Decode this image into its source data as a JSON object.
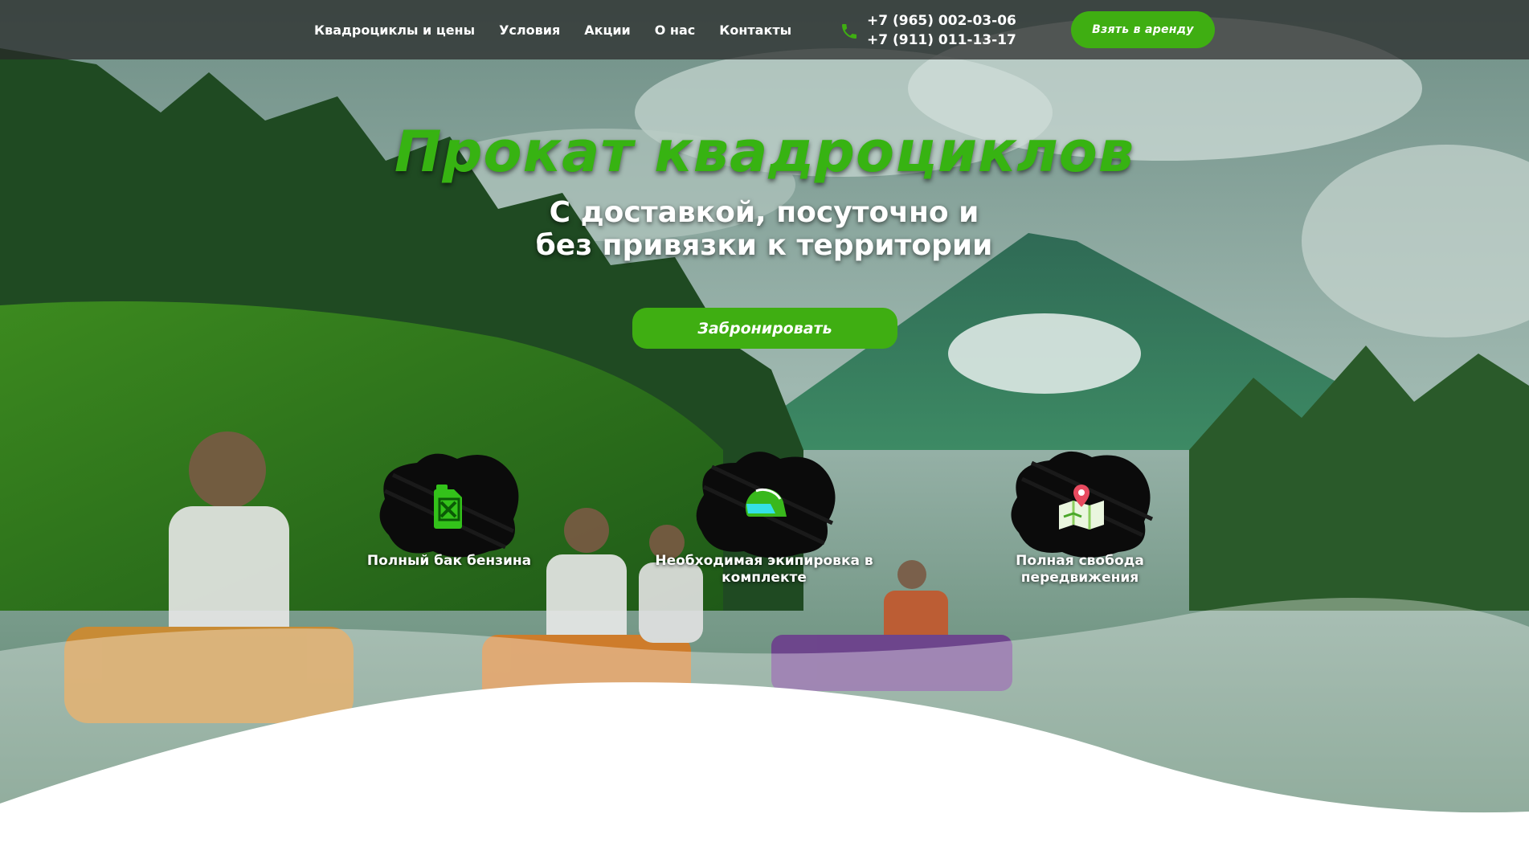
{
  "nav": {
    "items": [
      {
        "label": "Квадроциклы и цены"
      },
      {
        "label": "Условия"
      },
      {
        "label": "Акции"
      },
      {
        "label": "О нас"
      },
      {
        "label": "Контакты"
      }
    ]
  },
  "contacts": {
    "phones": [
      "+7 (965) 002-03-06",
      "+7 (911) 011-13-17"
    ],
    "icon": "phone-icon"
  },
  "header": {
    "rent_button": "Взять в аренду"
  },
  "hero": {
    "title": "Прокат квадроциклов",
    "subtitle": "С доставкой, посуточно и без привязки к территории",
    "book_button": "Забронировать"
  },
  "features": [
    {
      "label": "Полный бак бензина",
      "icon": "fuel-canister-icon"
    },
    {
      "label": "Необходимая экипировка в комплекте",
      "icon": "helmet-icon"
    },
    {
      "label": "Полная свобода передвижения",
      "icon": "map-pin-icon"
    }
  ],
  "colors": {
    "accent": "#3fae12",
    "title_green": "#37b312",
    "header_bg": "#282828",
    "text": "#ffffff"
  }
}
